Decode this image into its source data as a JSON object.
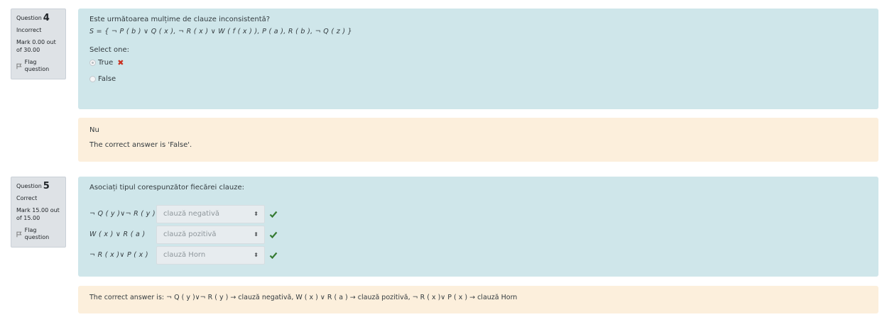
{
  "q4": {
    "info": {
      "question_label": "Question",
      "number": "4",
      "state": "Incorrect",
      "grade": "Mark 0.00 out of 30.00",
      "flag": "Flag question"
    },
    "text": "Este următoarea mulțime de clauze inconsistentă?",
    "formula": "S = { ¬ P ( b ) ∨ Q ( x ), ¬ R ( x ) ∨ W ( f ( x ) ), P ( a ), R ( b ), ¬ Q ( z ) }",
    "prompt": "Select one:",
    "options": [
      {
        "label": "True",
        "checked": true,
        "mark": "✖"
      },
      {
        "label": "False",
        "checked": false
      }
    ],
    "feedback": {
      "general": "Nu",
      "right_answer": "The correct answer is 'False'."
    }
  },
  "q5": {
    "info": {
      "question_label": "Question",
      "number": "5",
      "state": "Correct",
      "grade": "Mark 15.00 out of 15.00",
      "flag": "Flag question"
    },
    "text": "Asociați tipul corespunzător fiecărei clauze:",
    "rows": [
      {
        "stem": "¬ Q ( y )∨¬ R ( y )",
        "selected": "clauză negativă"
      },
      {
        "stem": "W ( x ) ∨ R ( a )",
        "selected": "clauză pozitivă"
      },
      {
        "stem": "¬ R ( x )∨ P ( x )",
        "selected": "clauză Horn"
      }
    ],
    "right_answer": "The correct answer is: ¬ Q ( y )∨¬ R ( y ) → clauză negativă, W ( x ) ∨ R ( a ) → clauză pozitivă, ¬ R ( x )∨ P ( x ) → clauză Horn"
  },
  "colors": {
    "formulation_bg": "#cfe6ea",
    "feedback_bg": "#fcefdc",
    "info_bg": "#dee2e6",
    "incorrect": "#ca3120",
    "correct": "#357a32"
  }
}
